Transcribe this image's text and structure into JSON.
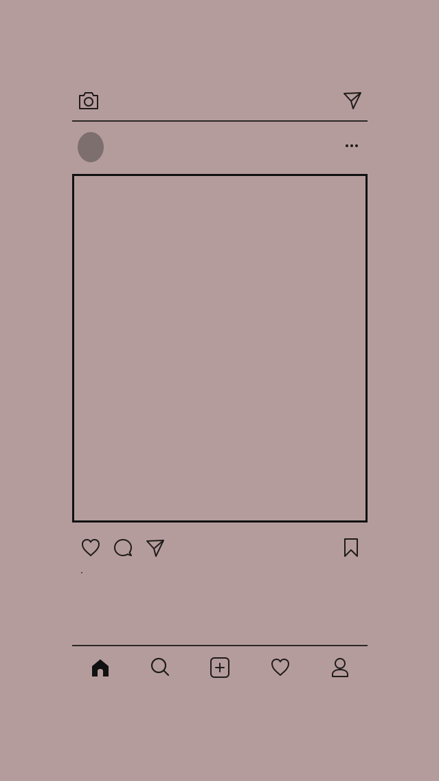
{
  "app": {
    "background_color": "#b59c9c",
    "line_color": "#2b2626",
    "avatar_color": "#7e6f6f",
    "frame_color": "#111111"
  },
  "top_bar": {
    "left_icon": "camera-icon",
    "right_icon": "direct-message-icon"
  },
  "post": {
    "header": {
      "menu_icon": "more-options-icon"
    },
    "actions": {
      "like_icon": "heart-icon",
      "comment_icon": "comment-icon",
      "share_icon": "send-icon",
      "save_icon": "bookmark-icon"
    }
  },
  "bottom_nav": {
    "items": [
      {
        "name": "home",
        "icon": "home-icon",
        "active": true
      },
      {
        "name": "search",
        "icon": "search-icon",
        "active": false
      },
      {
        "name": "create",
        "icon": "add-post-icon",
        "active": false
      },
      {
        "name": "activity",
        "icon": "heart-icon",
        "active": false
      },
      {
        "name": "profile",
        "icon": "profile-icon",
        "active": false
      }
    ]
  }
}
